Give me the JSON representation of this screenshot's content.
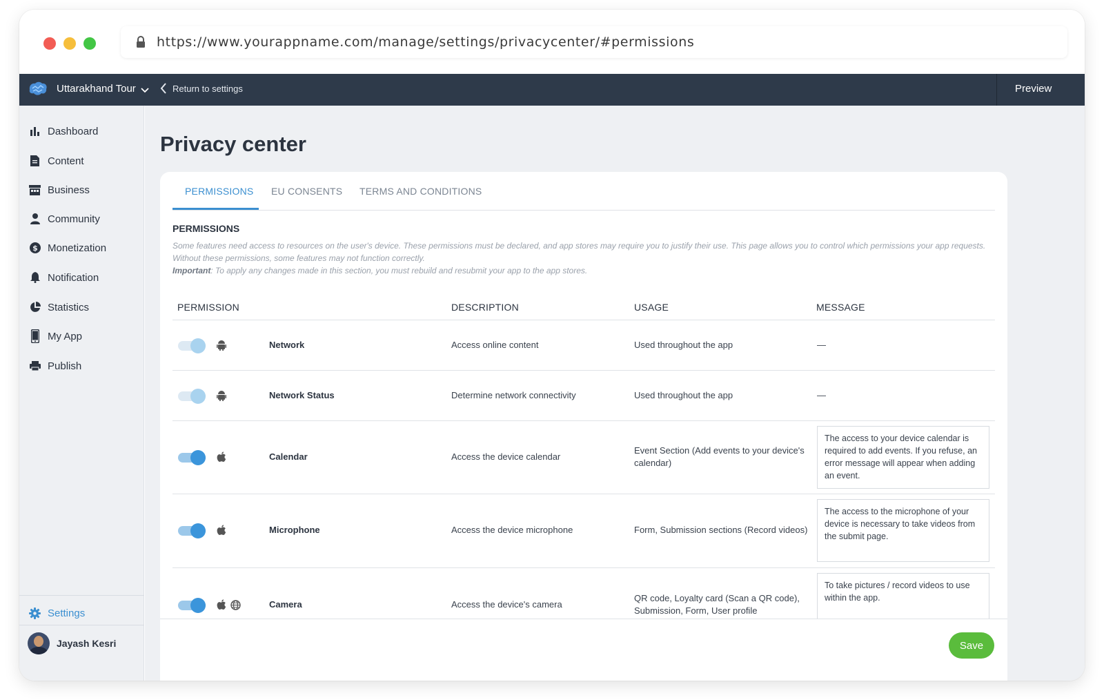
{
  "browser": {
    "url": "https://www.yourappname.com/manage/settings/privacycenter/#permissions"
  },
  "topbar": {
    "app_name": "Uttarakhand Tour",
    "return_label": "Return to settings",
    "preview_label": "Preview"
  },
  "sidebar": {
    "items": [
      {
        "label": "Dashboard",
        "icon": "bar-chart-icon"
      },
      {
        "label": "Content",
        "icon": "document-icon"
      },
      {
        "label": "Business",
        "icon": "store-icon"
      },
      {
        "label": "Community",
        "icon": "person-icon"
      },
      {
        "label": "Monetization",
        "icon": "dollar-icon"
      },
      {
        "label": "Notification",
        "icon": "bell-icon"
      },
      {
        "label": "Statistics",
        "icon": "pie-chart-icon"
      },
      {
        "label": "My App",
        "icon": "phone-icon"
      },
      {
        "label": "Publish",
        "icon": "printer-icon"
      }
    ],
    "settings_label": "Settings",
    "user_name": "Jayash Kesri"
  },
  "page": {
    "title": "Privacy center",
    "tabs": [
      "PERMISSIONS",
      "EU CONSENTS",
      "TERMS AND CONDITIONS"
    ],
    "active_tab": "PERMISSIONS",
    "section_title": "PERMISSIONS",
    "intro_text": "Some features need access to resources on the user's device. These permissions must be declared, and app stores may require you to justify their use. This page allows you to control which permissions your app requests. Without these permissions, some features may not function correctly.",
    "important_label": "Important",
    "important_text": ": To apply any changes made in this section, you must rebuild and resubmit your app to the app stores."
  },
  "table": {
    "headers": [
      "PERMISSION",
      "DESCRIPTION",
      "USAGE",
      "MESSAGE"
    ],
    "rows": [
      {
        "name": "Network",
        "description": "Access online content",
        "usage": "Used throughout the app",
        "message": "—",
        "enabled": true,
        "locked": true,
        "platforms": [
          "android"
        ]
      },
      {
        "name": "Network Status",
        "description": "Determine network connectivity",
        "usage": "Used throughout the app",
        "message": "—",
        "enabled": true,
        "locked": true,
        "platforms": [
          "android"
        ]
      },
      {
        "name": "Calendar",
        "description": "Access the device calendar",
        "usage": "Event Section (Add events to your device's calendar)",
        "message": "The access to your device calendar is required to add events. If you refuse, an error message will appear when adding an event.",
        "enabled": true,
        "locked": false,
        "platforms": [
          "apple"
        ]
      },
      {
        "name": "Microphone",
        "description": "Access the device microphone",
        "usage": "Form, Submission sections (Record videos)",
        "message": "The access to the microphone of your device is necessary to take videos from the submit page.",
        "enabled": true,
        "locked": false,
        "platforms": [
          "apple"
        ]
      },
      {
        "name": "Camera",
        "description": "Access the device's camera",
        "usage": "QR code, Loyalty card (Scan a QR code), Submission, Form, User profile",
        "message": "To take pictures / record videos to use within the app.",
        "enabled": true,
        "locked": false,
        "platforms": [
          "apple",
          "web"
        ]
      }
    ]
  },
  "footer": {
    "save_label": "Save"
  },
  "colors": {
    "accent": "#3b8fd0",
    "topbar": "#2e3a4a",
    "save": "#5abc3c",
    "toggle_on": "#3b95db"
  }
}
